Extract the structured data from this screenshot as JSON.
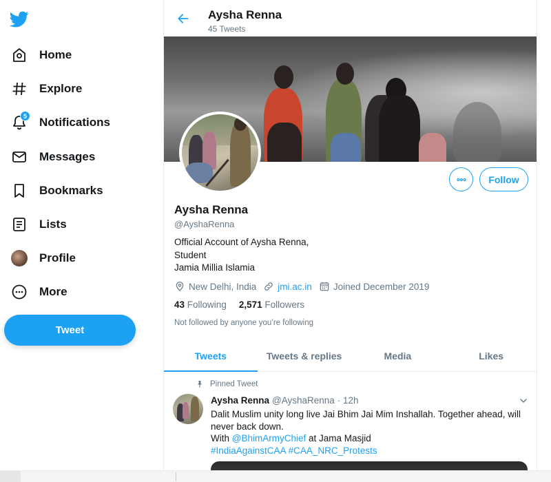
{
  "sidebar": {
    "logo_icon": "twitter-bird-icon",
    "items": [
      {
        "label": "Home",
        "icon": "home-icon"
      },
      {
        "label": "Explore",
        "icon": "hashtag-icon"
      },
      {
        "label": "Notifications",
        "icon": "bell-icon",
        "badge": "5"
      },
      {
        "label": "Messages",
        "icon": "envelope-icon"
      },
      {
        "label": "Bookmarks",
        "icon": "bookmark-icon"
      },
      {
        "label": "Lists",
        "icon": "list-icon"
      },
      {
        "label": "Profile",
        "icon": "avatar-icon"
      },
      {
        "label": "More",
        "icon": "more-circle-icon"
      }
    ],
    "tweet_button": "Tweet"
  },
  "header": {
    "name": "Aysha Renna",
    "tweet_count": "45 Tweets"
  },
  "profile": {
    "name": "Aysha Renna",
    "handle": "@AyshaRenna",
    "bio_line1": "Official Account of Aysha Renna,",
    "bio_line2": "Student",
    "bio_line3": "Jamia Millia Islamia",
    "location": "New Delhi, India",
    "website": "jmi.ac.in",
    "joined": "Joined December 2019",
    "following_count": "43",
    "following_label": "Following",
    "followers_count": "2,571",
    "followers_label": "Followers",
    "not_followed": "Not followed by anyone you’re following",
    "follow_button": "Follow"
  },
  "tabs": [
    {
      "label": "Tweets",
      "active": true
    },
    {
      "label": "Tweets & replies",
      "active": false
    },
    {
      "label": "Media",
      "active": false
    },
    {
      "label": "Likes",
      "active": false
    }
  ],
  "pinned_tweet": {
    "pinned_label": "Pinned Tweet",
    "name": "Aysha Renna",
    "handle": "@AyshaRenna",
    "time": "· 12h",
    "text_line1": "Dalit Muslim unity long live Jai Bhim Jai Mim Inshallah. Together ahead, will never back down.",
    "with_prefix": "With ",
    "mention": "@BhimArmyChief",
    "with_suffix": " at Jama Masjid",
    "hashtag1": "#IndiaAgainstCAA",
    "hashtag2": "#CAA_NRC_Protests"
  },
  "colors": {
    "accent": "#1da1f2",
    "text": "#14171a",
    "muted": "#657786"
  }
}
